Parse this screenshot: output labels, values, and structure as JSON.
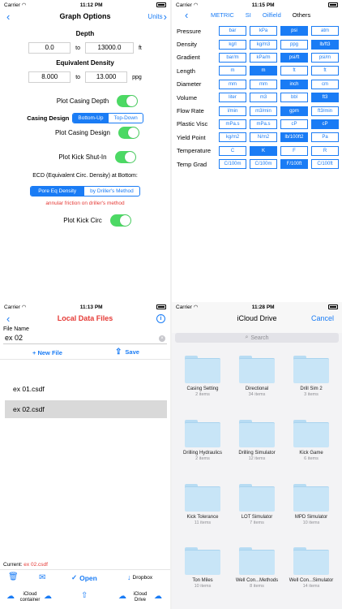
{
  "status": [
    {
      "carrier": "Carrier",
      "time": "11:12 PM"
    },
    {
      "carrier": "Carrier",
      "time": "11:15 PM"
    },
    {
      "carrier": "Carrier",
      "time": "11:13 PM"
    },
    {
      "carrier": "Carrier",
      "time": "11:28 PM"
    }
  ],
  "graph_options": {
    "title": "Graph Options",
    "units_label": "Units",
    "depth_label": "Depth",
    "depth_from": "0.0",
    "depth_to": "13000.0",
    "to_label": "to",
    "depth_unit": "ft",
    "ecd_label": "Equivalent Density",
    "ecd_from": "8.000",
    "ecd_to": "13.000",
    "ecd_unit": "ppg",
    "plot_casing_depth": "Plot Casing Depth",
    "casing_design": "Casing Design",
    "bottom_up": "Bottom-Up",
    "top_down": "Top-Down",
    "plot_casing_design": "Plot Casing Design",
    "plot_kick_shutin": "Plot Kick Shut-In",
    "ecd_at_bottom": "ECD (Equivalent Circ. Density) at Bottom:",
    "pore_eq": "Pore Eq Density",
    "drillers_method": "by Driller's Method",
    "annular_note": "annular friction on driller's method",
    "plot_kick_circ": "Plot Kick Circ",
    "note_color": "#e53935"
  },
  "units": {
    "tabs": [
      "METRIC",
      "SI",
      "Oilfield",
      "Others"
    ],
    "rows": [
      {
        "label": "Pressure",
        "cells": [
          "bar",
          "kPa",
          "psi",
          "atm"
        ],
        "on": 2
      },
      {
        "label": "Density",
        "cells": [
          "kg/l",
          "kg/m3",
          "ppg",
          "lb/ft3"
        ],
        "on": 3
      },
      {
        "label": "Gradient",
        "cells": [
          "bar/m",
          "kPa/m",
          "psi/ft",
          "psi/m"
        ],
        "on": 2
      },
      {
        "label": "Length",
        "cells": [
          "m",
          "m",
          "ft",
          "ft"
        ],
        "on": 1
      },
      {
        "label": "Diameter",
        "cells": [
          "mm",
          "mm",
          "inch",
          "cm"
        ],
        "on": 2
      },
      {
        "label": "Volume",
        "cells": [
          "liter",
          "m3",
          "bbl",
          "ft3"
        ],
        "on": 3
      },
      {
        "label": "Flow Rate",
        "cells": [
          "l/min",
          "m3/min",
          "gpm",
          "ft3/min"
        ],
        "on": 2
      },
      {
        "label": "Plastic Visc",
        "cells": [
          "mPa.s",
          "mPa.s",
          "cP",
          "cP"
        ],
        "on": 3
      },
      {
        "label": "Yield Point",
        "cells": [
          "kg/m2",
          "N/m2",
          "lb/100ft2",
          "Pa"
        ],
        "on": 2
      },
      {
        "label": "Temperature",
        "cells": [
          "C",
          "K",
          "F",
          "R"
        ],
        "on": 1
      },
      {
        "label": "Temp Grad",
        "cells": [
          "C/100m",
          "C/100m",
          "F/100ft",
          "C/100ft"
        ],
        "on": 2
      }
    ]
  },
  "local_files": {
    "title": "Local Data Files",
    "file_name_label": "File Name",
    "file_name_value": "ex 02",
    "new_file": "+ New File",
    "save": "Save",
    "files": [
      "ex 01.csdf",
      "ex 02.csdf"
    ],
    "current_label": "Current:",
    "current_value": "ex 02.csdf",
    "open": "Open",
    "dropbox": "Dropbox",
    "icloud_container": "iCloud container",
    "icloud_drive": "iCloud Drive"
  },
  "icloud": {
    "title": "iCloud Drive",
    "cancel": "Cancel",
    "search_placeholder": "Search",
    "folders": [
      {
        "name": "Casing Setting",
        "count": "2 items"
      },
      {
        "name": "Directional",
        "count": "34 items"
      },
      {
        "name": "Drill Sim 2",
        "count": "3 items"
      },
      {
        "name": "Drilling Hydraulics",
        "count": "2 items"
      },
      {
        "name": "Drilling Simulator",
        "count": "12 items"
      },
      {
        "name": "Kick Game",
        "count": "6 items"
      },
      {
        "name": "Kick Tolerance",
        "count": "11 items"
      },
      {
        "name": "LOT Simulator",
        "count": "7 items"
      },
      {
        "name": "MPD Simulator",
        "count": "10 items"
      },
      {
        "name": "Ton Miles",
        "count": "10 items"
      },
      {
        "name": "Well Con...Methods",
        "count": "8 items"
      },
      {
        "name": "Well Con...Simulator",
        "count": "14 items"
      }
    ]
  },
  "colors": {
    "accent": "#1a7cf5",
    "toggle_on": "#4cd964",
    "title_red": "#e53935"
  }
}
